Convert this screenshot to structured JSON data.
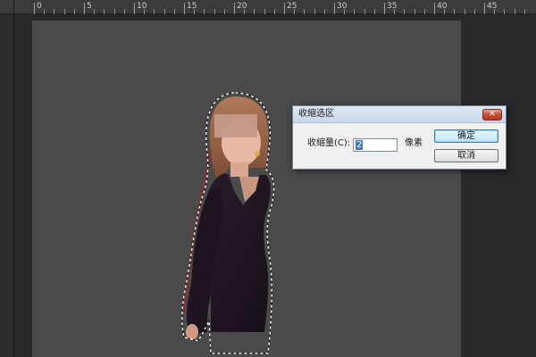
{
  "ruler": {
    "labels": [
      "0",
      "5",
      "10",
      "15",
      "20",
      "25",
      "30",
      "35",
      "40",
      "45"
    ]
  },
  "dialog": {
    "title": "收缩选区",
    "close_symbol": "✕",
    "amount_label": "收缩量(C):",
    "amount_value": "2",
    "unit_label": "像素",
    "ok_label": "确定",
    "cancel_label": "取消"
  },
  "colors": {
    "canvas": "#4a4a4a",
    "workspace": "#282828",
    "dialog_bg": "#f0f0f0",
    "selection_marching_ants": "#ffffff"
  }
}
